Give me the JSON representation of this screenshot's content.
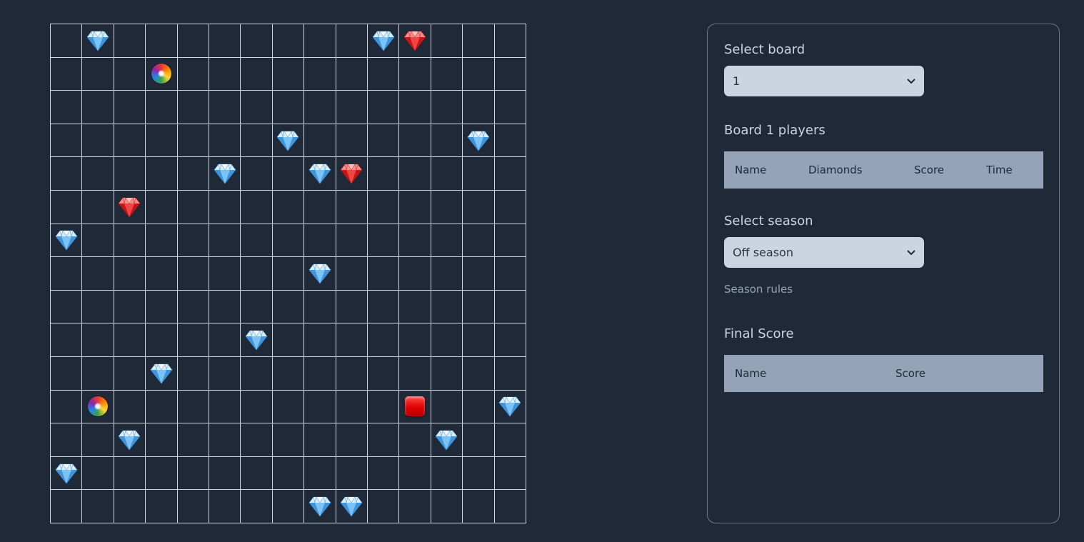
{
  "board": {
    "rows": 15,
    "cols": 15,
    "items": [
      {
        "row": 0,
        "col": 1,
        "type": "blue-diamond"
      },
      {
        "row": 0,
        "col": 10,
        "type": "blue-diamond"
      },
      {
        "row": 0,
        "col": 11,
        "type": "red-diamond"
      },
      {
        "row": 1,
        "col": 3,
        "type": "teleporter"
      },
      {
        "row": 3,
        "col": 7,
        "type": "blue-diamond"
      },
      {
        "row": 3,
        "col": 13,
        "type": "blue-diamond"
      },
      {
        "row": 4,
        "col": 5,
        "type": "blue-diamond"
      },
      {
        "row": 4,
        "col": 8,
        "type": "blue-diamond"
      },
      {
        "row": 4,
        "col": 9,
        "type": "red-diamond"
      },
      {
        "row": 5,
        "col": 2,
        "type": "red-diamond"
      },
      {
        "row": 6,
        "col": 0,
        "type": "blue-diamond"
      },
      {
        "row": 7,
        "col": 8,
        "type": "blue-diamond"
      },
      {
        "row": 9,
        "col": 6,
        "type": "blue-diamond"
      },
      {
        "row": 10,
        "col": 3,
        "type": "blue-diamond"
      },
      {
        "row": 11,
        "col": 1,
        "type": "teleporter"
      },
      {
        "row": 11,
        "col": 11,
        "type": "red-button"
      },
      {
        "row": 11,
        "col": 14,
        "type": "blue-diamond"
      },
      {
        "row": 12,
        "col": 2,
        "type": "blue-diamond"
      },
      {
        "row": 12,
        "col": 12,
        "type": "blue-diamond"
      },
      {
        "row": 13,
        "col": 0,
        "type": "blue-diamond"
      },
      {
        "row": 14,
        "col": 8,
        "type": "blue-diamond"
      },
      {
        "row": 14,
        "col": 9,
        "type": "blue-diamond"
      }
    ]
  },
  "panel": {
    "select_board_label": "Select board",
    "select_board_value": "1",
    "players_title": "Board 1 players",
    "players_columns": [
      "Name",
      "Diamonds",
      "Score",
      "Time"
    ],
    "select_season_label": "Select season",
    "select_season_value": "Off season",
    "season_rules": "Season rules",
    "final_score_title": "Final Score",
    "final_score_columns": [
      "Name",
      "Score"
    ]
  },
  "colors": {
    "background": "#1f2937",
    "grid_line": "#cfd6df",
    "select_bg": "#cbd5e1",
    "table_head_bg": "#94a3b8"
  },
  "icons": {
    "blue-diamond": "blue-diamond-icon",
    "red-diamond": "red-diamond-icon",
    "teleporter": "teleporter-icon",
    "red-button": "red-button-icon"
  }
}
